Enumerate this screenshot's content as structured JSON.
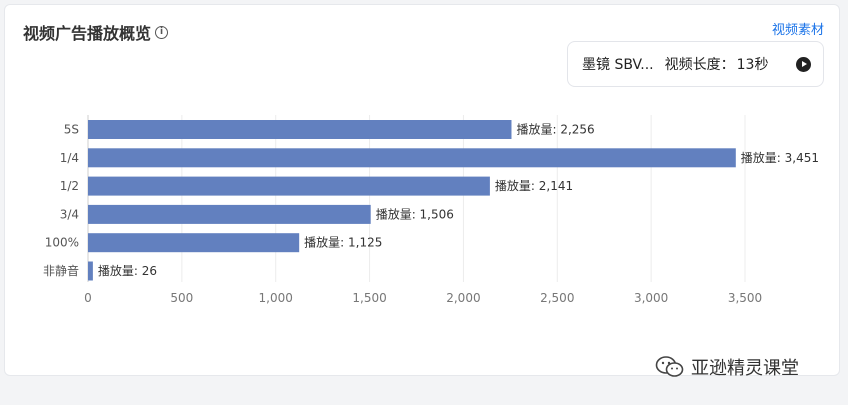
{
  "header": {
    "title": "视频广告播放概览",
    "info_icon": "info-icon",
    "material_link": "视频素材"
  },
  "video_selector": {
    "name": "墨镜 SBV...",
    "length_label": "视频长度：",
    "length_value": "13秒",
    "play_icon": "play-circle-icon"
  },
  "chart_data": {
    "type": "bar",
    "orientation": "horizontal",
    "categories": [
      "5S",
      "1/4",
      "1/2",
      "3/4",
      "100%",
      "非静音"
    ],
    "values": [
      2256,
      3451,
      2141,
      1506,
      1125,
      26
    ],
    "value_labels": [
      "播放量: 2,256",
      "播放量: 3,451",
      "播放量: 2,141",
      "播放量: 1,506",
      "播放量: 1,125",
      "播放量: 26"
    ],
    "xticks": [
      "0",
      "500",
      "1,000",
      "1,500",
      "2,000",
      "2,500",
      "3,000",
      "3,500"
    ],
    "xtick_values": [
      0,
      500,
      1000,
      1500,
      2000,
      2500,
      3000,
      3500
    ],
    "xlim": [
      0,
      3500
    ],
    "grid": true,
    "bar_color": "#6280bf"
  },
  "watermark": {
    "icon": "wechat-icon",
    "text": "亚逊精灵课堂"
  }
}
